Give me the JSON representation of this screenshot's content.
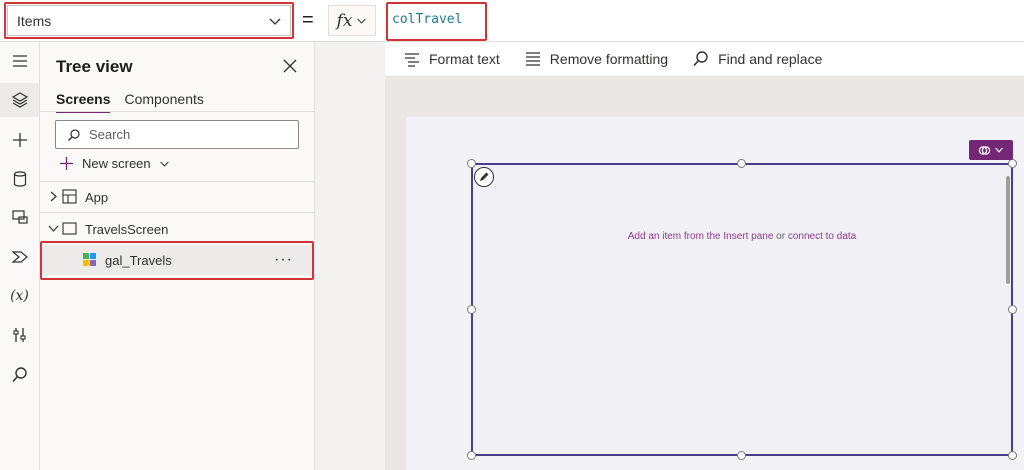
{
  "formula_bar": {
    "property_value": "Items",
    "equals": "=",
    "fx_label": "fx",
    "formula_text": "colTravel"
  },
  "ribbon": {
    "items": [
      {
        "label": "Format text",
        "icon": "format-text-icon"
      },
      {
        "label": "Remove formatting",
        "icon": "remove-formatting-icon"
      },
      {
        "label": "Find and replace",
        "icon": "search-icon"
      }
    ]
  },
  "left_rail": {
    "icons": [
      "hamburger-menu-icon",
      "layers-icon",
      "insert-plus-icon",
      "database-icon",
      "media-icon",
      "power-automate-icon",
      "variables-icon",
      "tools-icon",
      "search-icon"
    ],
    "variables_label": "(x)"
  },
  "tree_view": {
    "title": "Tree view",
    "tabs": [
      {
        "label": "Screens",
        "active": true
      },
      {
        "label": "Components",
        "active": false
      }
    ],
    "search_placeholder": "Search",
    "new_screen_label": "New screen",
    "nodes": {
      "app": {
        "label": "App"
      },
      "screen": {
        "label": "TravelsScreen"
      },
      "gallery": {
        "label": "gal_Travels",
        "more": "···"
      }
    }
  },
  "canvas": {
    "gallery_message_part1": "Add an item from the Insert pane",
    "gallery_message_or": " or ",
    "gallery_message_link": "connect to data"
  },
  "colors": {
    "accent": "#742774",
    "highlight_border": "#d13438",
    "formula_text": "#1e7b8f",
    "gallery_border": "#4b3c8c"
  }
}
